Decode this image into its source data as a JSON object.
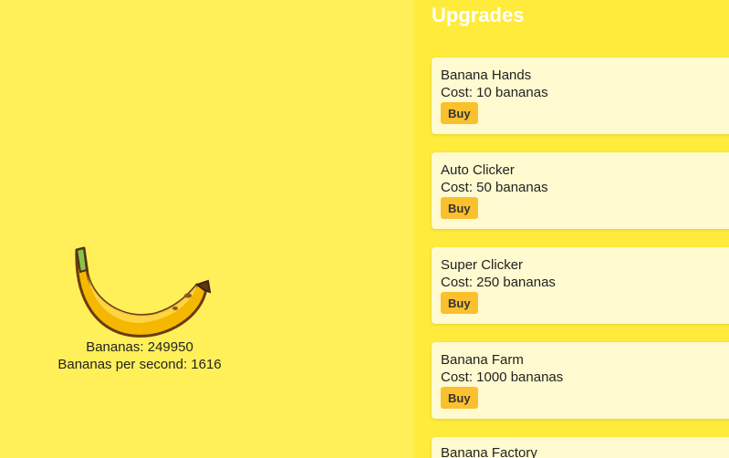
{
  "stats": {
    "bananas_label": "Bananas: 249950",
    "bps_label": "Bananas per second: 1616"
  },
  "upgrades": {
    "title": "Upgrades",
    "items": [
      {
        "name": "Banana Hands",
        "cost": "Cost: 10 bananas",
        "buy_label": "Buy"
      },
      {
        "name": "Auto Clicker",
        "cost": "Cost: 50 bananas",
        "buy_label": "Buy"
      },
      {
        "name": "Super Clicker",
        "cost": "Cost: 250 bananas",
        "buy_label": "Buy"
      },
      {
        "name": "Banana Farm",
        "cost": "Cost: 1000 bananas",
        "buy_label": "Buy"
      },
      {
        "name": "Banana Factory",
        "cost": "",
        "buy_label": ""
      }
    ]
  },
  "colors": {
    "left_bg": "#fff059",
    "right_bg": "#ffeb3b",
    "card_bg": "#fffad0",
    "buy_button": "#fbc02d",
    "title": "#ffffff"
  },
  "icons": {
    "banana": "banana-icon"
  }
}
